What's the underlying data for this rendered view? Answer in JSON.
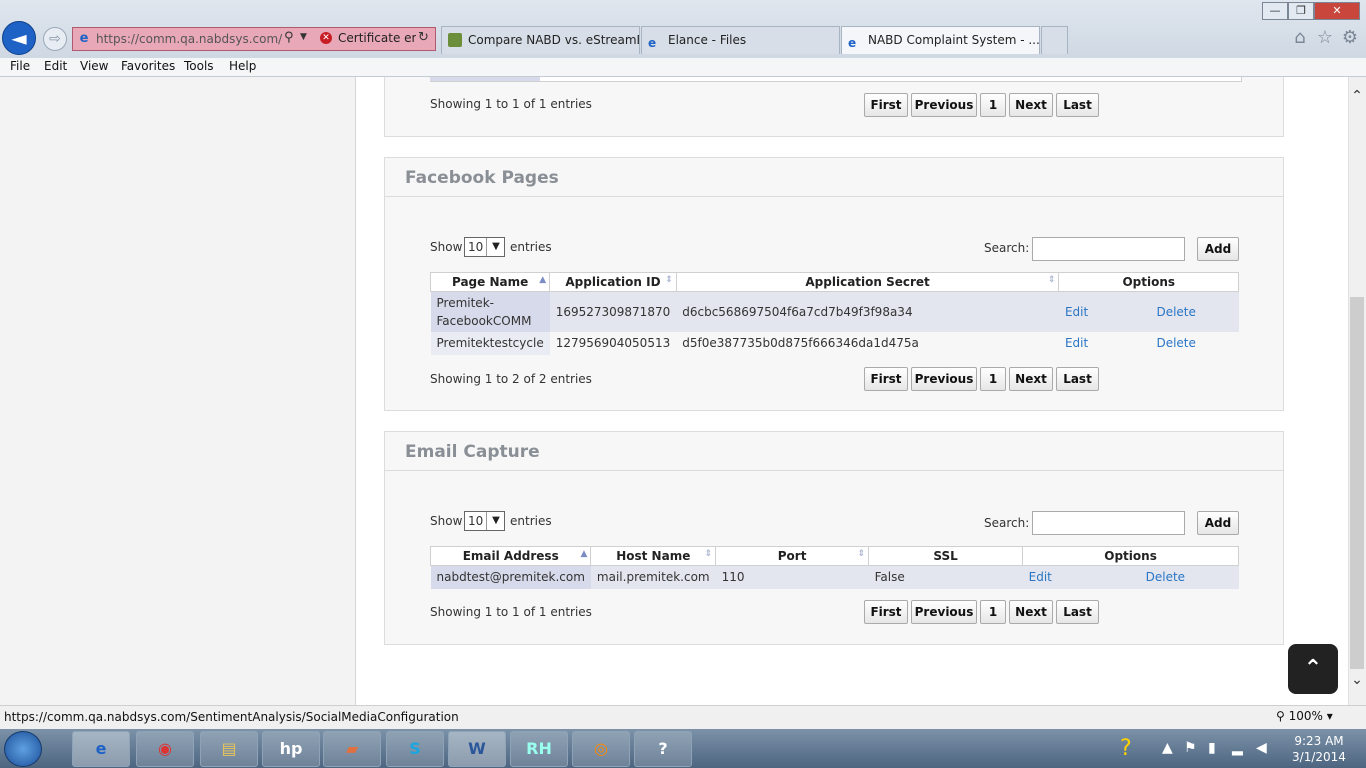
{
  "browser": {
    "address_url": "https://comm.qa.nabdsys.com/Se",
    "cert_label": "Certificate er...",
    "tabs": [
      {
        "label": "Compare NABD vs. eStreamDe..."
      },
      {
        "label": "Elance - Files"
      },
      {
        "label": "NABD Complaint System - ..."
      }
    ],
    "tab_close": "×",
    "menu": [
      "File",
      "Edit",
      "View",
      "Favorites",
      "Tools",
      "Help"
    ],
    "status_url": "https://comm.qa.nabdsys.com/SentimentAnalysis/SocialMediaConfiguration",
    "zoom": "100%",
    "zoom_arrow": "▾",
    "icons": {
      "back": "◄",
      "forward": "⇨",
      "search": "⚲",
      "refresh": "↻",
      "home": "⌂",
      "favorites": "☆",
      "gear": "⚙",
      "minimize": "—",
      "maximize": "❐",
      "close": "✕"
    }
  },
  "pagination": {
    "first": "First",
    "previous": "Previous",
    "page": "1",
    "next": "Next",
    "last": "Last"
  },
  "common": {
    "show": "Show",
    "entries": "entries",
    "search": "Search:",
    "add": "Add",
    "page_size": "10",
    "edit": "Edit",
    "delete": "Delete"
  },
  "top_section": {
    "info": "Showing 1 to 1 of 1 entries"
  },
  "facebook": {
    "title": "Facebook Pages",
    "columns": [
      "Page Name",
      "Application ID",
      "Application Secret",
      "Options"
    ],
    "rows": [
      {
        "page_name": "Premitek-FacebookCOMM",
        "app_id": "169527309871870",
        "secret": "d6cbc568697504f6a7cd7b49f3f98a34"
      },
      {
        "page_name": "Premitektestcycle",
        "app_id": "127956904050513",
        "secret": "d5f0e387735b0d875f666346da1d475a"
      }
    ],
    "info": "Showing 1 to 2 of 2 entries"
  },
  "email": {
    "title": "Email Capture",
    "columns": [
      "Email Address",
      "Host Name",
      "Port",
      "SSL",
      "Options"
    ],
    "rows": [
      {
        "address": "nabdtest@premitek.com",
        "host": "mail.premitek.com",
        "port": "110",
        "ssl": "False"
      }
    ],
    "info": "Showing 1 to 1 of 1 entries"
  },
  "scroll_top_glyph": "⌃",
  "taskbar": {
    "clock_time": "9:23 AM",
    "clock_date": "3/1/2014",
    "apps": [
      "e",
      "◉",
      "▤",
      "hp",
      "▰",
      "S",
      "W",
      "RH",
      "◎",
      "?"
    ]
  },
  "colors": {
    "link": "#2a76c5",
    "panel_title": "#8a8f96",
    "address_error": "#e8a8b8",
    "sorted_column": "#d6daea"
  }
}
